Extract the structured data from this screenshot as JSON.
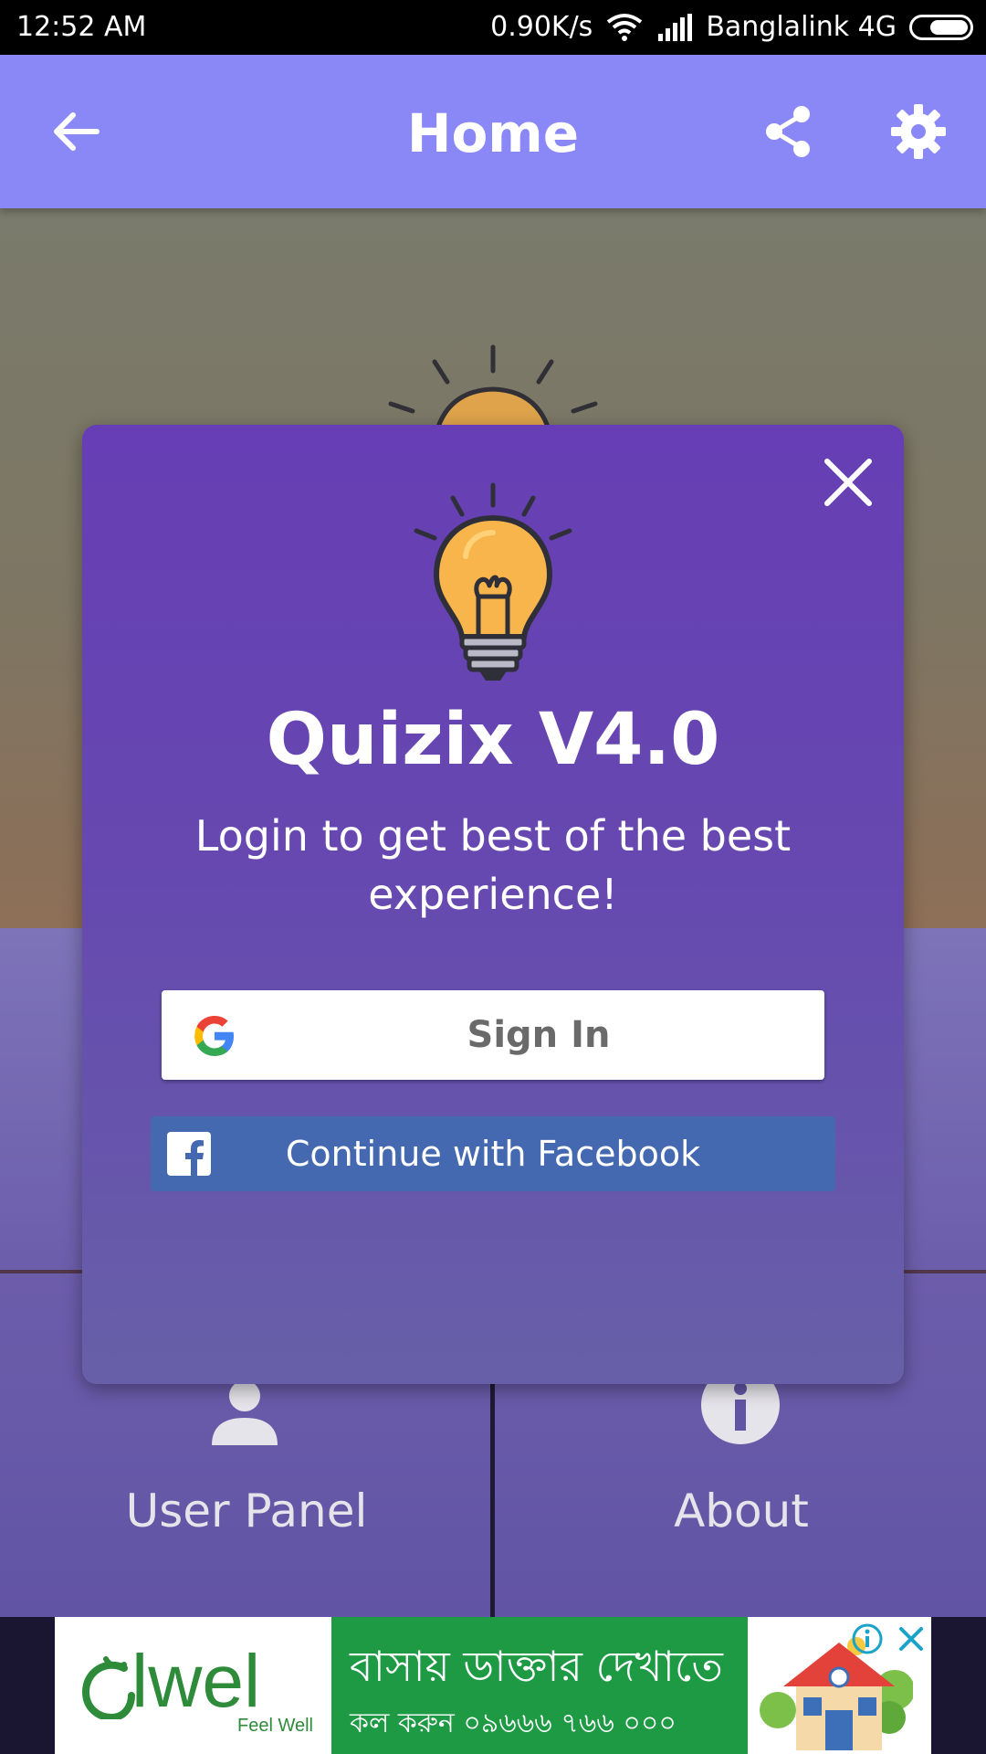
{
  "status_bar": {
    "time": "12:52 AM",
    "net_speed": "0.90K/s",
    "carrier": "Banglalink 4G",
    "icons": [
      "wifi-icon",
      "signal-icon",
      "battery-icon"
    ]
  },
  "app_bar": {
    "title": "Home",
    "color": "#8a88f7",
    "icons": [
      "back-arrow-icon",
      "share-icon",
      "gear-icon"
    ]
  },
  "tiles": [
    {
      "label": "User Panel",
      "icon": "user-icon"
    },
    {
      "label": "About",
      "icon": "info-icon"
    }
  ],
  "dialog": {
    "title": "Quizix V4.0",
    "subtitle": "Login to get best of the best experience!",
    "google_button": "Sign In",
    "facebook_button": "Continue with Facebook",
    "icons": [
      "close-icon",
      "lightbulb-icon",
      "google-icon",
      "facebook-icon"
    ],
    "color": "#673eb5"
  },
  "ad": {
    "brand": "lwel",
    "tagline": "Feel Well",
    "headline": "বাসায় ডাক্তার দেখাতে",
    "phone": "কল করুন ০৯৬৬৬ ৭৬৬ ০০০",
    "icons": [
      "ad-info-icon",
      "ad-close-icon",
      "house-icon"
    ]
  }
}
